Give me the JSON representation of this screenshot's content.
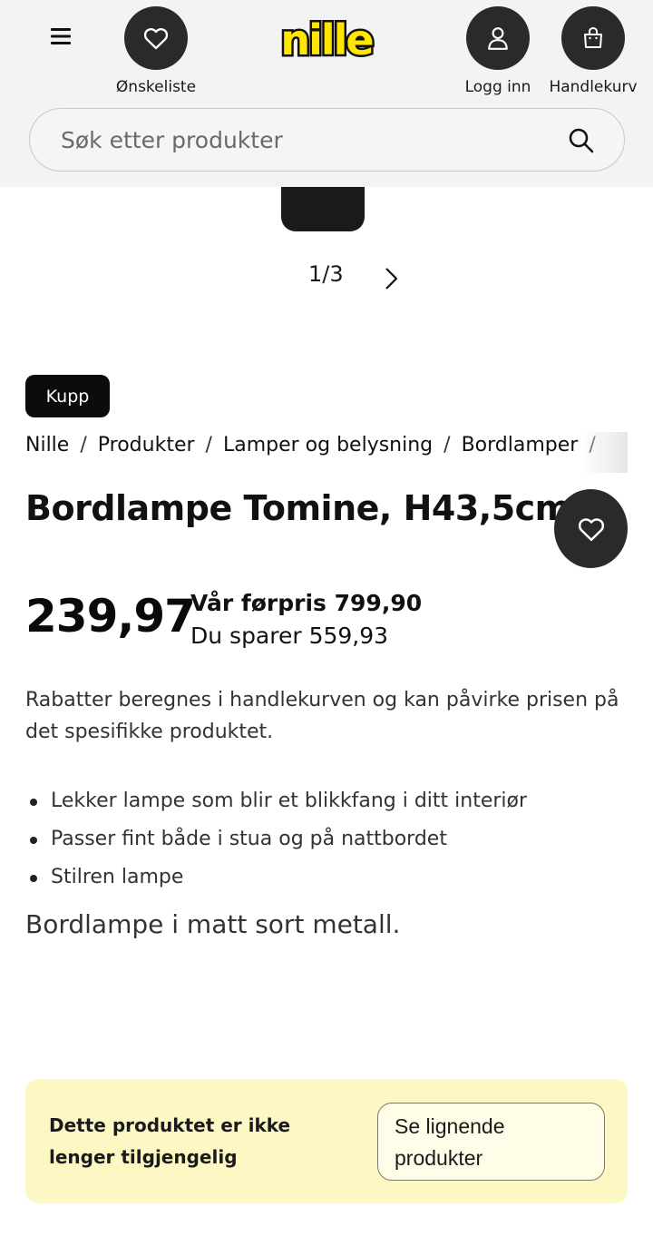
{
  "header": {
    "menu_icon": "hamburger-menu-icon",
    "wishlist_label": "Ønskeliste",
    "wishlist_icon": "heart-icon",
    "logo_text": "nille",
    "login_label": "Logg inn",
    "login_icon": "user-icon",
    "cart_label": "Handlekurv",
    "cart_icon": "shopping-bag-icon",
    "brand_color": "#ffe600"
  },
  "search": {
    "placeholder": "Søk etter produkter",
    "icon": "search-icon"
  },
  "gallery": {
    "pager": "1/3",
    "next_icon": "chevron-right-icon"
  },
  "product": {
    "badge": "Kupp",
    "breadcrumb": [
      "Nille",
      "Produkter",
      "Lamper og belysning",
      "Bordlamper"
    ],
    "title": "Bordlampe Tomine, H43,5cm",
    "favorite_icon": "heart-icon",
    "price": "239,97",
    "old_price": "Vår førpris 799,90",
    "savings": "Du sparer 559,93",
    "discount_info": "Rabatter beregnes i handlekurven og kan påvirke prisen på det spesifikke produktet.",
    "bullets": [
      "Lekker lampe som blir et blikkfang i ditt interiør",
      "Passer fint både i stua og på nattbordet",
      "Stilren lampe"
    ],
    "description": "Bordlampe i matt sort metall."
  },
  "unavailable": {
    "message": "Dette produktet er ikke lenger tilgjengelig",
    "button_label": "Se lignende produkter",
    "bg_color": "#fdf7c3"
  }
}
